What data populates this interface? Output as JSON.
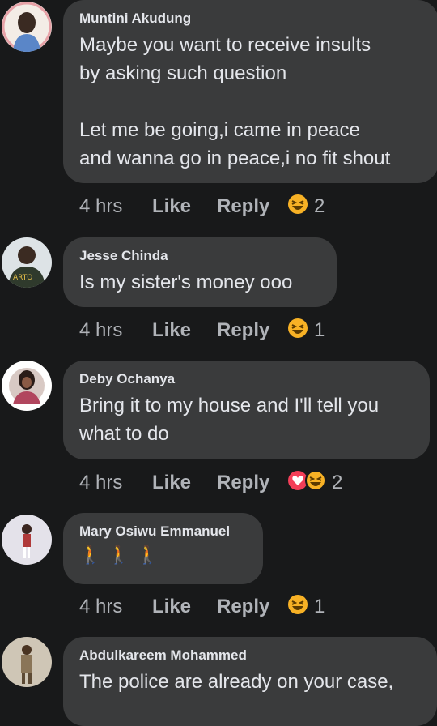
{
  "comments": [
    {
      "name": "Muntini Akudung",
      "text": "Maybe you want to receive insults\nby asking such question\n\nLet me be going,i came in peace\nand wanna go in peace,i no fit shout",
      "time": "4 hrs",
      "like": "Like",
      "reply": "Reply",
      "reaction_icons": [
        "laughing-emoji"
      ],
      "reaction_count": "2"
    },
    {
      "name": "Jesse Chinda",
      "text": "Is my sister's money ooo",
      "time": "4 hrs",
      "like": "Like",
      "reply": "Reply",
      "reaction_icons": [
        "laughing-emoji"
      ],
      "reaction_count": "1"
    },
    {
      "name": "Deby Ochanya",
      "text": "Bring it to my house and I'll tell you\nwhat to do",
      "time": "4 hrs",
      "like": "Like",
      "reply": "Reply",
      "reaction_icons": [
        "love-heart",
        "laughing-emoji"
      ],
      "reaction_count": "2"
    },
    {
      "name": "Mary Osiwu Emmanuel",
      "text": "🚶🚶🚶",
      "time": "4 hrs",
      "like": "Like",
      "reply": "Reply",
      "reaction_icons": [
        "laughing-emoji"
      ],
      "reaction_count": "1"
    },
    {
      "name": "Abdulkareem Mohammed",
      "text": "The police are already on your case,",
      "time": "",
      "like": "",
      "reply": "",
      "reaction_icons": [],
      "reaction_count": ""
    }
  ],
  "colors": {
    "background": "#18191a",
    "bubble": "#3a3b3c",
    "primary_text": "#e4e6eb",
    "secondary_text": "#b0b3b8",
    "emoji_yellow": "#f7b125",
    "love_red": "#f33e58"
  }
}
